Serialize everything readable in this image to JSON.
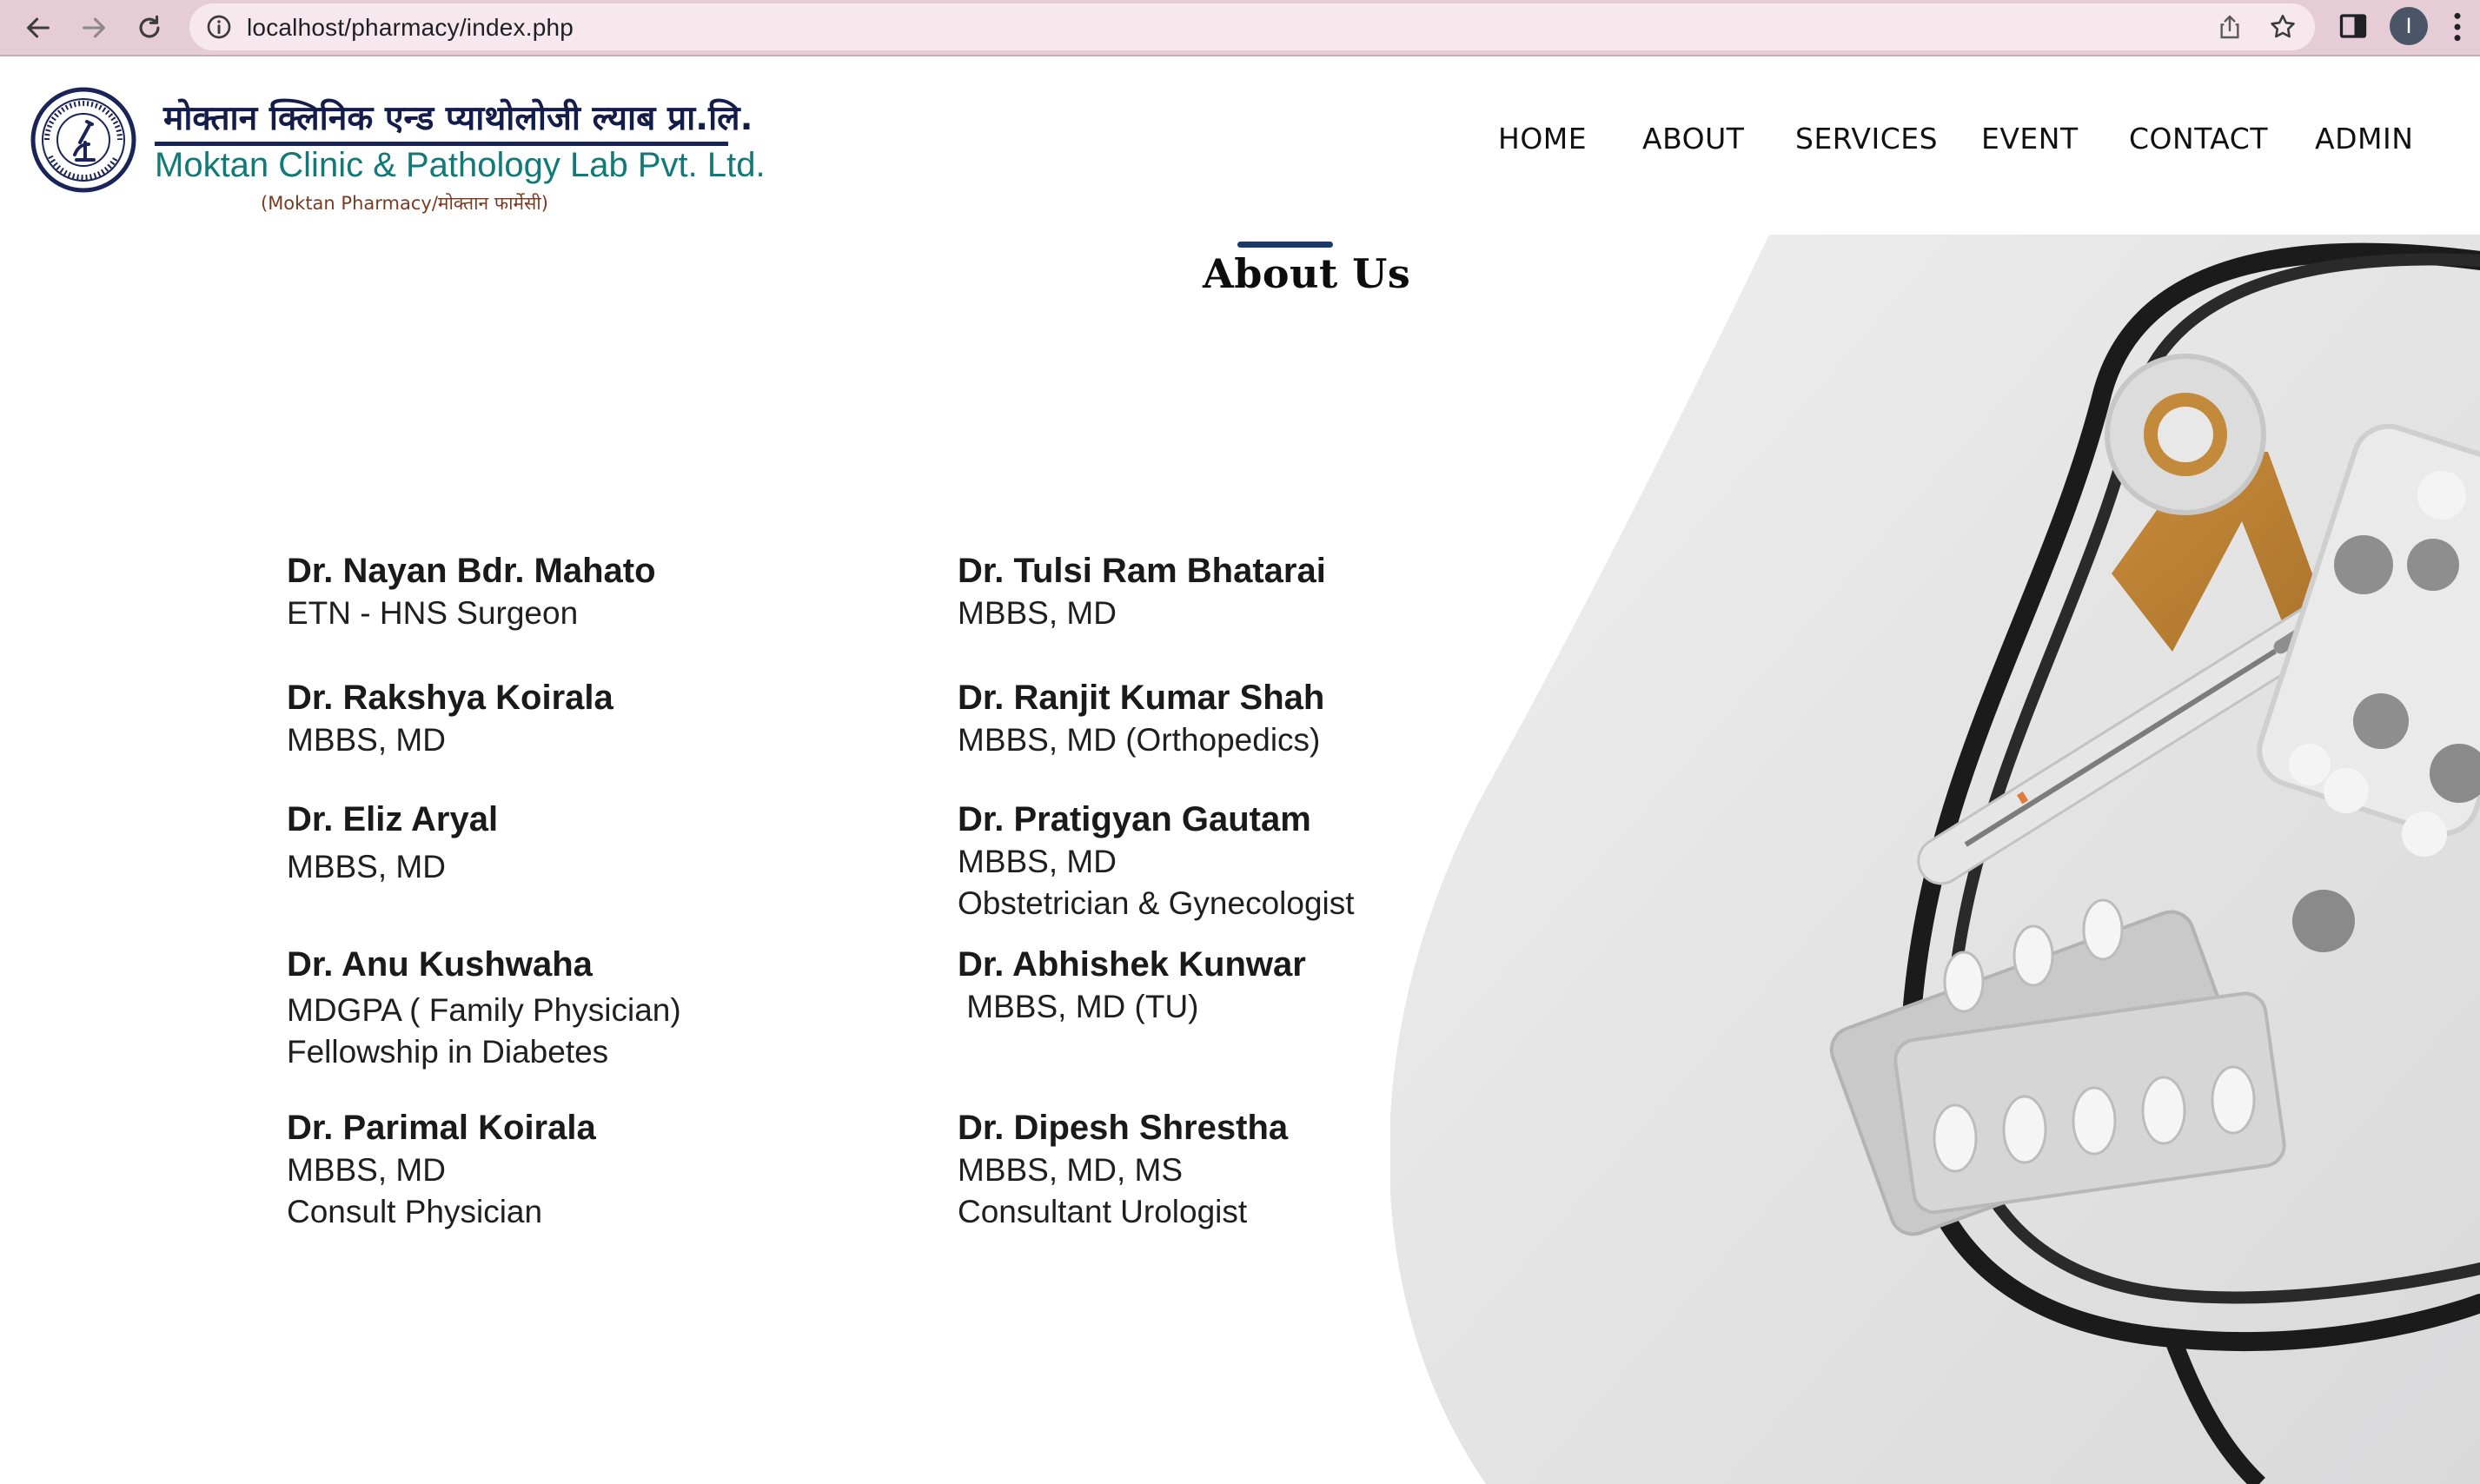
{
  "browser": {
    "url": "localhost/pharmacy/index.php",
    "profile_initial": "I"
  },
  "brand": {
    "nepali_name": "मोक्तान क्लिनिक एन्ड प्याथोलोजी ल्याब प्रा.लि.",
    "english_name": "Moktan Clinic & Pathology Lab Pvt. Ltd.",
    "subtitle": "(Moktan Pharmacy/मोक्तान फार्मेसी)",
    "colors": {
      "navy": "#1b2459",
      "teal": "#0f7a78",
      "brown": "#7a3a22"
    }
  },
  "nav": {
    "items": [
      {
        "label": "HOME"
      },
      {
        "label": "ABOUT"
      },
      {
        "label": "SERVICES"
      },
      {
        "label": "EVENT"
      },
      {
        "label": "CONTACT"
      },
      {
        "label": "ADMIN"
      }
    ]
  },
  "about": {
    "title": "About Us",
    "doctors": [
      {
        "name": "Dr.  Nayan Bdr.  Mahato",
        "lines": [
          "ETN - HNS  Surgeon"
        ]
      },
      {
        "name": "Dr.  Tulsi Ram Bhatarai",
        "lines": [
          "MBBS, MD"
        ]
      },
      {
        "name": "Dr.  Rakshya Koirala",
        "lines": [
          "MBBS, MD"
        ]
      },
      {
        "name": "Dr.  Ranjit Kumar Shah",
        "lines": [
          "MBBS, MD (Orthopedics)"
        ]
      },
      {
        "name": "Dr. Eliz Aryal",
        "lines": [
          "MBBS, MD"
        ]
      },
      {
        "name": "Dr.  Pratigyan Gautam",
        "lines": [
          "MBBS, MD",
          "Obstetrician & Gynecologist"
        ]
      },
      {
        "name": "Dr.  Anu Kushwaha",
        "lines": [
          "MDGPA ( Family Physician)",
          "Fellowship in Diabetes"
        ]
      },
      {
        "name": "Dr.  Abhishek Kunwar",
        "lines": [
          " MBBS, MD (TU)"
        ]
      },
      {
        "name": "Dr.  Parimal Koirala",
        "lines": [
          "MBBS, MD",
          "Consult Physician"
        ]
      },
      {
        "name": "Dr. Dipesh Shrestha",
        "lines": [
          "MBBS, MD, MS",
          "Consultant Urologist"
        ]
      }
    ]
  }
}
